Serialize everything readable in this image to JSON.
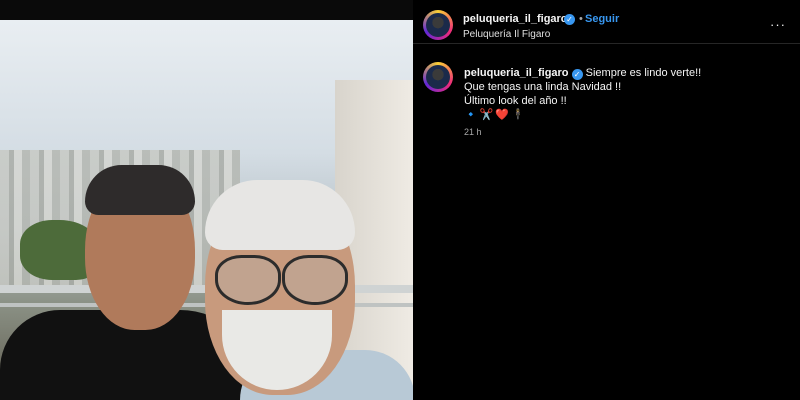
{
  "post": {
    "username": "peluqueria_il_figaro",
    "location": "Peluquería Il Figaro",
    "follow_label": "Seguir",
    "separator": "•",
    "more_label": "···"
  },
  "caption": {
    "username": "peluqueria_il_figaro",
    "line1": "Siempre es lindo verte!!",
    "line2": "Que tengas una linda Navidad !!",
    "line3": "Último look del año !!",
    "emojis": "🔹✂️❤️🕴",
    "time": "21 h"
  },
  "colors": {
    "background": "#000000",
    "accent": "#3897f0",
    "muted": "#a8a8a8"
  },
  "icons": [
    "verified-badge-icon",
    "more-options-icon"
  ]
}
